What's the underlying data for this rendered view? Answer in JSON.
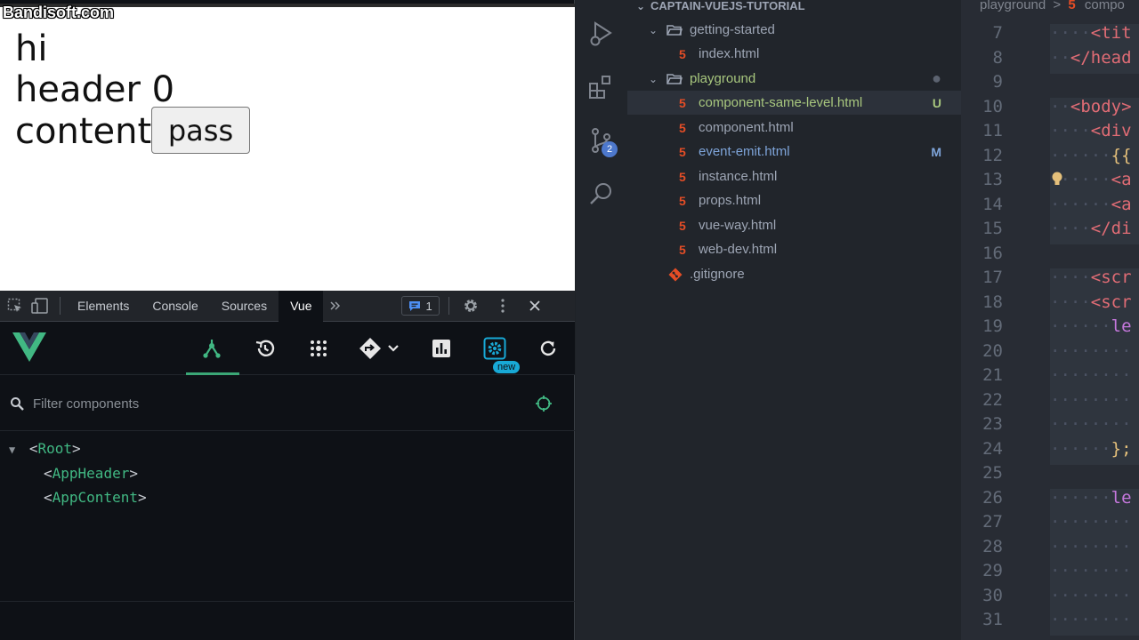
{
  "watermark": "Bandisoft.com",
  "page": {
    "line1": "hi",
    "line2": "header 0",
    "line3": "content",
    "button_label": "pass"
  },
  "devtools": {
    "tabs": [
      "Elements",
      "Console",
      "Sources",
      "Vue"
    ],
    "active_tab": "Vue",
    "more_icon": "double-chevron-right-icon",
    "issues_count": "1",
    "filter_placeholder": "Filter components",
    "new_badge": "new",
    "tree": {
      "root": "Root",
      "children": [
        "AppHeader",
        "AppContent"
      ]
    }
  },
  "vscode": {
    "breadcrumb": {
      "folder": "playground",
      "sep": ">",
      "file": "compo"
    },
    "project": "CAPTAIN-VUEJS-TUTORIAL",
    "scm_count": "2",
    "explorer": {
      "getting_started": "getting-started",
      "index_file": "index.html",
      "playground": "playground",
      "files": [
        {
          "name": "component-same-level.html",
          "status": "U",
          "color": "#a8c77e"
        },
        {
          "name": "component.html",
          "status": "",
          "color": "#9da5b4"
        },
        {
          "name": "event-emit.html",
          "status": "M",
          "color": "#7ea4d9"
        },
        {
          "name": "instance.html",
          "status": "",
          "color": "#9da5b4"
        },
        {
          "name": "props.html",
          "status": "",
          "color": "#9da5b4"
        },
        {
          "name": "vue-way.html",
          "status": "",
          "color": "#9da5b4"
        },
        {
          "name": "web-dev.html",
          "status": "",
          "color": "#9da5b4"
        }
      ],
      "gitignore": ".gitignore"
    },
    "line_numbers": [
      "7",
      "8",
      "9",
      "10",
      "11",
      "12",
      "13",
      "14",
      "15",
      "16",
      "17",
      "18",
      "19",
      "20",
      "21",
      "22",
      "23",
      "24",
      "25",
      "26",
      "27",
      "28",
      "29",
      "30",
      "31"
    ],
    "code_lines": [
      {
        "ws": "····",
        "text": "<tit",
        "color": "#e06c75"
      },
      {
        "ws": "··",
        "text": "</head",
        "color": "#e06c75"
      },
      {
        "ws": "",
        "text": "",
        "color": "#abb2bf"
      },
      {
        "ws": "··",
        "text": "<body>",
        "color": "#e06c75"
      },
      {
        "ws": "····",
        "text": "<div",
        "color": "#e06c75"
      },
      {
        "ws": "······",
        "text": "{{",
        "color": "#e5c07b"
      },
      {
        "ws": "······",
        "text": "<a",
        "color": "#e06c75"
      },
      {
        "ws": "······",
        "text": "<a",
        "color": "#e06c75"
      },
      {
        "ws": "····",
        "text": "</di",
        "color": "#e06c75"
      },
      {
        "ws": "",
        "text": "",
        "color": "#abb2bf"
      },
      {
        "ws": "····",
        "text": "<scr",
        "color": "#e06c75"
      },
      {
        "ws": "····",
        "text": "<scr",
        "color": "#e06c75"
      },
      {
        "ws": "······",
        "text": "le",
        "color": "#c678dd"
      },
      {
        "ws": "········",
        "text": "",
        "color": "#abb2bf"
      },
      {
        "ws": "········",
        "text": "",
        "color": "#abb2bf"
      },
      {
        "ws": "········",
        "text": "",
        "color": "#abb2bf"
      },
      {
        "ws": "········",
        "text": "",
        "color": "#abb2bf"
      },
      {
        "ws": "······",
        "text": "};",
        "color": "#e5c07b"
      },
      {
        "ws": "",
        "text": "",
        "color": "#abb2bf"
      },
      {
        "ws": "······",
        "text": "le",
        "color": "#c678dd"
      },
      {
        "ws": "········",
        "text": "",
        "color": "#abb2bf"
      },
      {
        "ws": "········",
        "text": "",
        "color": "#abb2bf"
      },
      {
        "ws": "········",
        "text": "",
        "color": "#abb2bf"
      },
      {
        "ws": "········",
        "text": "",
        "color": "#abb2bf"
      },
      {
        "ws": "········",
        "text": "",
        "color": "#abb2bf"
      }
    ]
  }
}
